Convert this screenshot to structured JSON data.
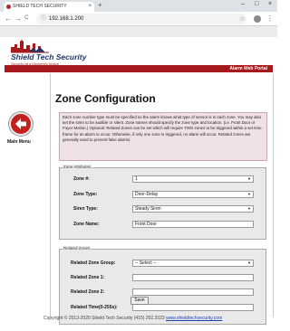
{
  "browser": {
    "tab_title": "SHIELD TECH SECURITY",
    "tab_close": "×",
    "new_tab": "+",
    "minimize": "–",
    "maximize": "□",
    "close": "×",
    "back": "←",
    "forward": "→",
    "reload": "C",
    "url": "192.168.1.200",
    "info_icon": "ⓘ",
    "star": "☆",
    "menu": "⋮"
  },
  "header": {
    "logo_name": "Shield Tech Security",
    "logo_tagline": "Security at a Moment's Notice",
    "portal_link": "Alarm Web Portal"
  },
  "sidebar": {
    "main_menu_label": "Main Menu"
  },
  "main": {
    "title": "Zone Configuration",
    "description": "Each zone number type must be specified so the alarm knows what type of sensor is in each zone. You may also set the siren to be audible or silent. Zone names should specify the zone type and location. (i.e. Front Door or Foyer Motion.) Optional: Related Zones can be set which will require TWO zones to be triggered within a set time frame for an alarm to occur. Otherwise, if only one zone is triggered, no alarm will occur. Related zones are generally used to prevent false alarms."
  },
  "zone_attributes": {
    "legend": "Zone Attributes",
    "zone_number_label": "Zone #:",
    "zone_number_value": "1",
    "zone_type_label": "Zone Type:",
    "zone_type_value": "Door-Delay",
    "siren_type_label": "Siren Type:",
    "siren_type_value": "Steady Siren",
    "zone_name_label": "Zone Name:",
    "zone_name_value": "Front Door"
  },
  "related_zones": {
    "legend": "Related Zones",
    "group_label": "Related Zone Group:",
    "group_value": "-- Select --",
    "zone1_label": "Related Zone 1:",
    "zone2_label": "Related Zone 2:",
    "time_label": "Related Time(0-255s):"
  },
  "actions": {
    "save_label": "Save"
  },
  "footer": {
    "text": "Copyright © 2013-2020    Shield Tech Security    (415) 202.2023",
    "link": "www.shieldtechsecurity.com"
  },
  "colors": {
    "brand_red": "#a8191d",
    "brand_navy": "#1e3a6d",
    "desc_background": "#f0e1e4"
  }
}
